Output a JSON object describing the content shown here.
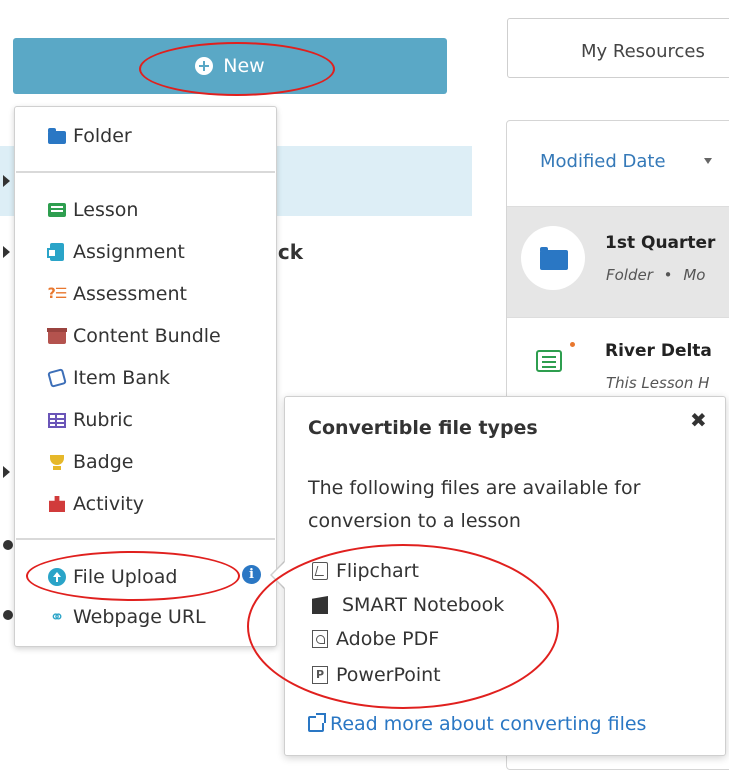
{
  "new_button": {
    "label": "New"
  },
  "background_list": {
    "row_resource_pack": "rce Pack"
  },
  "right_panel": {
    "tab_label": "My Resources",
    "sort": {
      "label": "Modified Date"
    },
    "rows": [
      {
        "title": "1st Quarter",
        "meta_type": "Folder",
        "meta_sep": "•",
        "meta_rest": "Mo"
      },
      {
        "title": "River Delta",
        "meta": "This Lesson H"
      }
    ]
  },
  "menu": {
    "items": [
      {
        "label": "Folder",
        "icon": "folder-icon"
      },
      {
        "label": "Lesson",
        "icon": "lesson-icon"
      },
      {
        "label": "Assignment",
        "icon": "assignment-icon"
      },
      {
        "label": "Assessment",
        "icon": "assessment-icon"
      },
      {
        "label": "Content Bundle",
        "icon": "content-bundle-icon"
      },
      {
        "label": "Item Bank",
        "icon": "item-bank-icon"
      },
      {
        "label": "Rubric",
        "icon": "rubric-icon"
      },
      {
        "label": "Badge",
        "icon": "badge-icon"
      },
      {
        "label": "Activity",
        "icon": "activity-icon"
      },
      {
        "label": "File Upload",
        "icon": "upload-icon"
      },
      {
        "label": "Webpage URL",
        "icon": "link-icon"
      }
    ],
    "info_icon": "i"
  },
  "popover": {
    "title": "Convertible file types",
    "close": "✖",
    "description": "The following files are available for conversion to a lesson",
    "file_types": [
      {
        "label": "Flipchart",
        "icon": "flipchart-icon"
      },
      {
        "label": "SMART Notebook",
        "icon": "smart-notebook-icon"
      },
      {
        "label": "Adobe PDF",
        "icon": "pdf-icon"
      },
      {
        "label": "PowerPoint",
        "icon": "powerpoint-icon",
        "glyph": "P"
      }
    ],
    "link": "Read more about converting files"
  },
  "colors": {
    "new_button_bg": "#5aa8c6",
    "link_blue": "#2a77c4",
    "annotation_red": "#e0201e"
  }
}
